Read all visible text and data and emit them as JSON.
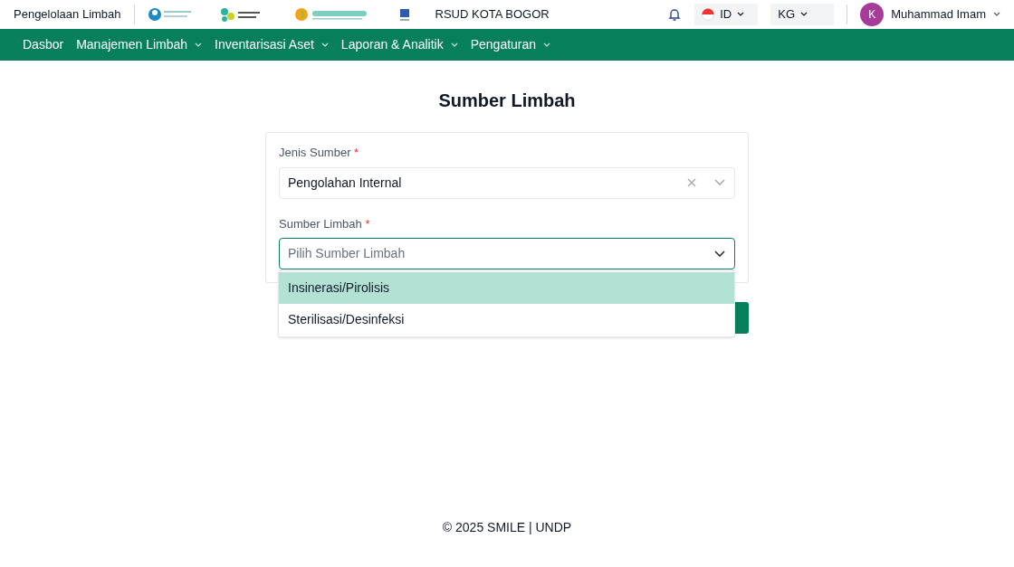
{
  "header": {
    "app_name": "Pengelolaan Limbah",
    "hospital": "RSUD KOTA BOGOR",
    "language": "ID",
    "unit": "KG",
    "user": {
      "initial": "K",
      "name": "Muhammad Imam"
    }
  },
  "nav": [
    {
      "label": "Dasbor",
      "has_menu": false
    },
    {
      "label": "Manajemen Limbah",
      "has_menu": true
    },
    {
      "label": "Inventarisasi Aset",
      "has_menu": true
    },
    {
      "label": "Laporan & Analitik",
      "has_menu": true
    },
    {
      "label": "Pengaturan",
      "has_menu": true
    }
  ],
  "page_title": "Sumber Limbah",
  "form": {
    "fields": [
      {
        "label": "Jenis Sumber",
        "required_mark": "*",
        "value": "Pengolahan Internal",
        "clearable": true,
        "focused": false
      },
      {
        "label": "Sumber Limbah",
        "required_mark": "*",
        "placeholder": "Pilih Sumber Limbah",
        "clearable": false,
        "focused": true
      }
    ]
  },
  "dropdown": [
    {
      "label": "Insinerasi/Pirolisis",
      "selected": true
    },
    {
      "label": "Sterilisasi/Desinfeksi",
      "selected": false
    }
  ],
  "footer": "© 2025 SMILE | UNDP"
}
